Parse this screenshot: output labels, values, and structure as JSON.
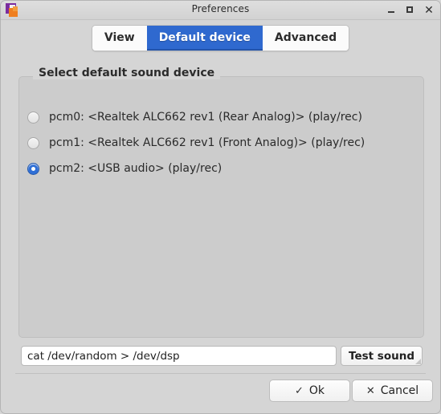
{
  "window": {
    "title": "Preferences",
    "icon": "app-icon",
    "controls": {
      "minimize": "–",
      "maximize": "□",
      "close": "✕"
    }
  },
  "tabs": [
    {
      "label": "View",
      "selected": false
    },
    {
      "label": "Default device",
      "selected": true
    },
    {
      "label": "Advanced",
      "selected": false
    }
  ],
  "group": {
    "title": "Select default sound device",
    "devices": [
      {
        "label": "pcm0: <Realtek ALC662 rev1 (Rear Analog)> (play/rec)",
        "selected": false
      },
      {
        "label": "pcm1: <Realtek ALC662 rev1 (Front Analog)> (play/rec)",
        "selected": false
      },
      {
        "label": "pcm2: <USB audio> (play/rec)",
        "selected": true
      }
    ]
  },
  "command": {
    "value": "cat /dev/random > /dev/dsp",
    "placeholder": "",
    "test_button": "Test sound"
  },
  "actions": {
    "ok_label": "Ok",
    "ok_glyph": "✓",
    "cancel_label": "Cancel",
    "cancel_glyph": "✕"
  },
  "colors": {
    "accent": "#2f69cf",
    "window_bg": "#d5d5d5",
    "group_bg": "#cccccc"
  }
}
